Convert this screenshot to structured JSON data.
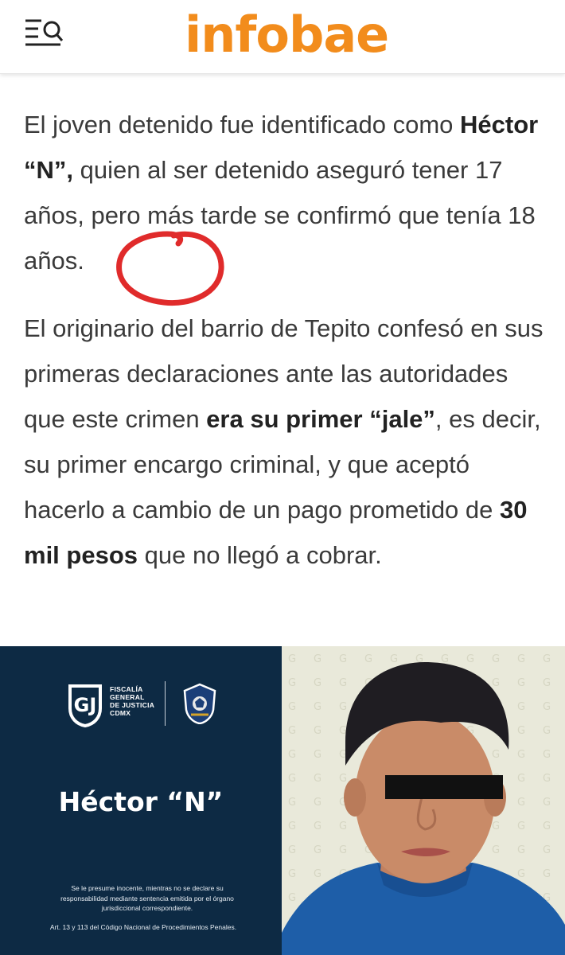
{
  "header": {
    "logo_text": "infobae",
    "logo_color": "#f28c1c",
    "menu_icon": "menu-search-icon"
  },
  "article": {
    "p1": {
      "t1": "El joven detenido fue identificado como ",
      "b1": "Héctor “N”,",
      "t2": " quien al ser detenido aseguró tener 17 años, pero más tarde se confirmó que tenía 18 años."
    },
    "p2": {
      "t1": "El originario del barrio de Tepito confesó en sus primeras declaraciones ante las autoridades que este crimen ",
      "b1": "era su primer “jale”",
      "t2": ", es decir, su primer encargo criminal, y que aceptó hacerlo a cambio de un pago prometido de ",
      "b2": "30 mil pesos",
      "t3": " que no llegó a cobrar."
    },
    "annotation_color": "#e02b2b"
  },
  "figure": {
    "agency_lines": [
      "FISCALÍA",
      "GENERAL",
      "DE JUSTICIA",
      "CDMX"
    ],
    "name": "Héctor “N”",
    "legal_text": "Se le presume inocente, mientras no se declare su responsabilidad mediante sentencia emitida por el órgano jurisdiccional correspondiente.",
    "legal_reference": "Art. 13 y 113 del Código Nacional de Procedimientos Penales.",
    "panel_color": "#0d2a44"
  }
}
